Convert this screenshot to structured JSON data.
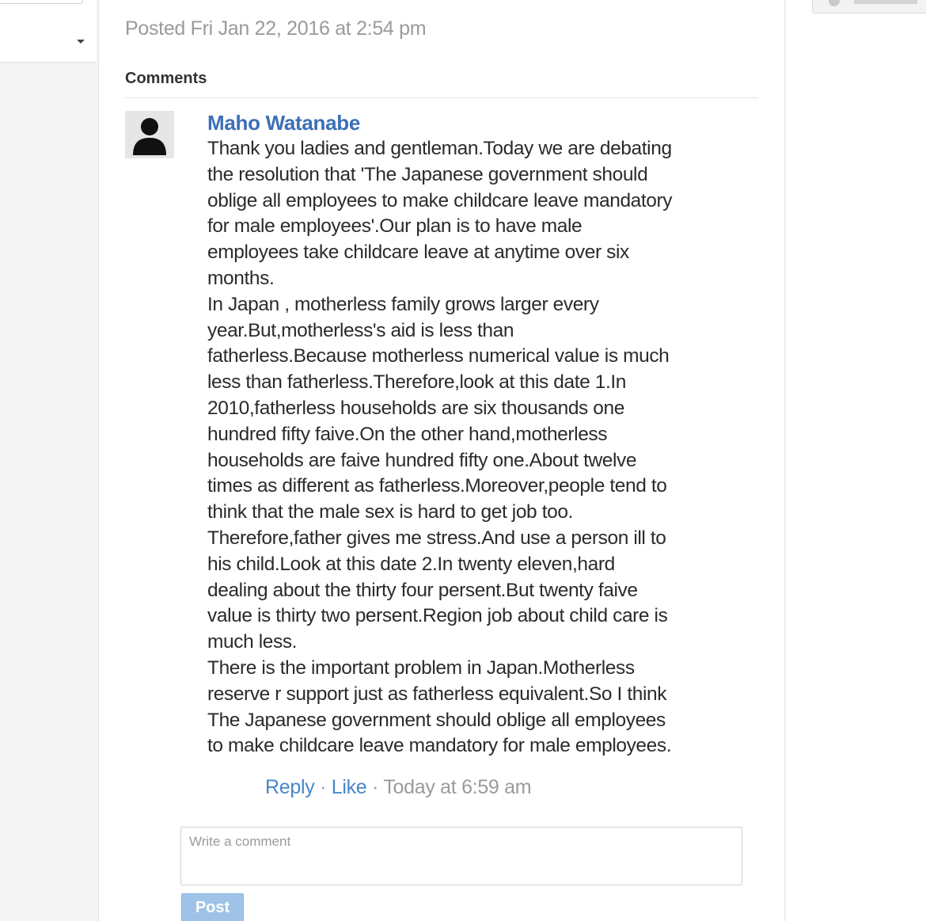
{
  "post": {
    "posted_text": "Posted Fri Jan 22, 2016 at 2:54 pm"
  },
  "comments_section": {
    "heading": "Comments",
    "comments": [
      {
        "avatar_icon": "user-silhouette-icon",
        "author": "Maho Watanabe",
        "lines": [
          "Thank you ladies and gentleman.Today we are debating",
          "the resolution that 'The Japanese government should",
          "oblige all employees to make childcare leave mandatory",
          "for male employees'.Our plan is to have male",
          "employees take childcare leave at anytime over six",
          "months.",
          "In Japan , motherless family grows larger every",
          "year.But,motherless's aid is less than",
          "fatherless.Because motherless numerical value is much",
          "less than fatherless.Therefore,look at this date 1.In",
          "2010,fatherless households are six thousands one",
          "hundred fifty faive.On the other hand,motherless",
          "households are faive hundred fifty one.About twelve",
          "times as different as fatherless.Moreover,people tend to",
          "think that the male sex is hard to get job too.",
          "Therefore,father gives me stress.And use a person ill to",
          "his child.Look at this date 2.In twenty eleven,hard",
          "dealing about the thirty four persent.But twenty faive",
          "value is thirty two persent.Region job about child care is",
          "much less.",
          "There is the important problem in Japan.Motherless",
          "reserve r support just as fatherless equivalent.So I think",
          "The Japanese government should oblige all employees",
          "to make childcare leave mandatory for male employees."
        ],
        "reply_label": "Reply",
        "like_label": "Like",
        "separator": "·",
        "time": "Today at 6:59 am"
      }
    ]
  },
  "comment_form": {
    "placeholder": "Write a comment",
    "value": "",
    "post_label": "Post"
  },
  "colors": {
    "link": "#4a86c8",
    "author": "#3b6fb6",
    "muted_text": "#9a9a9a",
    "post_button": "#9ec3e6"
  }
}
